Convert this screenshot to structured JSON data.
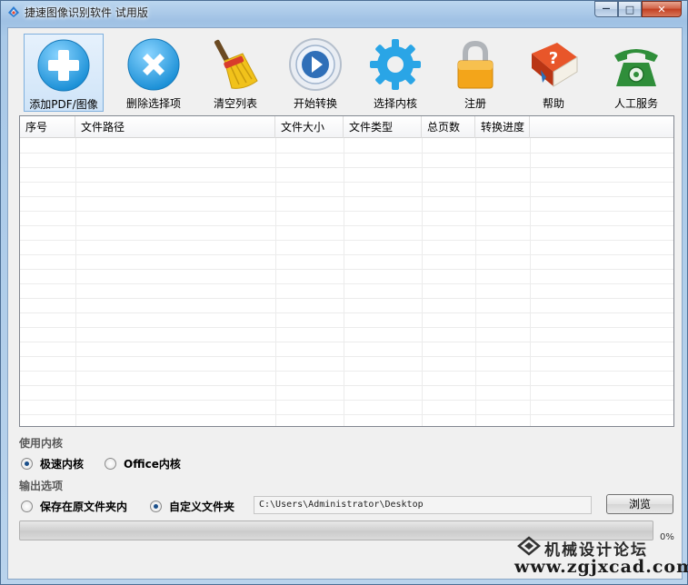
{
  "window": {
    "title": "捷速图像识别软件 试用版",
    "minimize_glyph": "—",
    "maximize_glyph": "□",
    "close_glyph": "✕"
  },
  "toolbar": {
    "items": [
      {
        "label": "添加PDF/图像",
        "icon": "add-plus-icon",
        "active": true
      },
      {
        "label": "删除选择项",
        "icon": "delete-x-icon"
      },
      {
        "label": "清空列表",
        "icon": "broom-icon"
      },
      {
        "label": "开始转换",
        "icon": "play-icon"
      },
      {
        "label": "选择内核",
        "icon": "gear-icon"
      },
      {
        "label": "注册",
        "icon": "lock-icon"
      },
      {
        "label": "帮助",
        "icon": "help-book-icon"
      },
      {
        "label": "人工服务",
        "icon": "telephone-icon"
      }
    ]
  },
  "file_list": {
    "columns": [
      "序号",
      "文件路径",
      "文件大小",
      "文件类型",
      "总页数",
      "转换进度"
    ],
    "rows": []
  },
  "engine": {
    "section_label": "使用内核",
    "options": [
      {
        "label": "极速内核",
        "checked": true
      },
      {
        "label": "Office内核",
        "checked": false
      }
    ]
  },
  "output": {
    "section_label": "输出选项",
    "options": [
      {
        "label": "保存在原文件夹内",
        "checked": false
      },
      {
        "label": "自定义文件夹",
        "checked": true
      }
    ],
    "path_value": "C:\\Users\\Administrator\\Desktop",
    "browse_label": "浏览"
  },
  "progress": {
    "value": 0,
    "label": "0%"
  },
  "watermark": {
    "title": "机械设计论坛",
    "url": "www.zgjxcad.com"
  },
  "colors": {
    "accent_blue": "#2a9fe0",
    "active_tool_border": "#7fb0de"
  }
}
